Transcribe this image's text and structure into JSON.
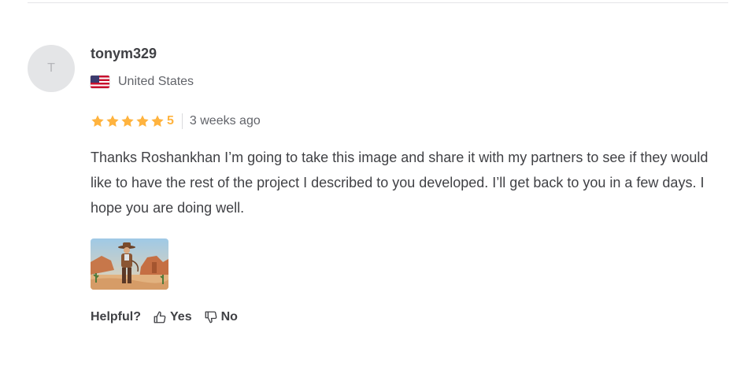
{
  "review": {
    "avatar_letter": "T",
    "username": "tonym329",
    "country": "United States",
    "country_flag_icon": "us-flag-icon",
    "rating": 5,
    "rating_label": "5",
    "time_ago": "3 weeks ago",
    "text": "Thanks Roshankhan I’m going to take this image and share it with my partners to see if they would like to have the rest of the project I described to you developed. I’ll get back to you in a few days. I hope you are doing well.",
    "attachment_icon": "cowboy-desert-thumbnail"
  },
  "helpful": {
    "label": "Helpful?",
    "yes_label": "Yes",
    "no_label": "No",
    "yes_icon": "thumbs-up-icon",
    "no_icon": "thumbs-down-icon"
  },
  "colors": {
    "star": "#ffb33e",
    "text": "#404145",
    "muted": "#62646a",
    "avatar_bg": "#e4e5e7"
  }
}
